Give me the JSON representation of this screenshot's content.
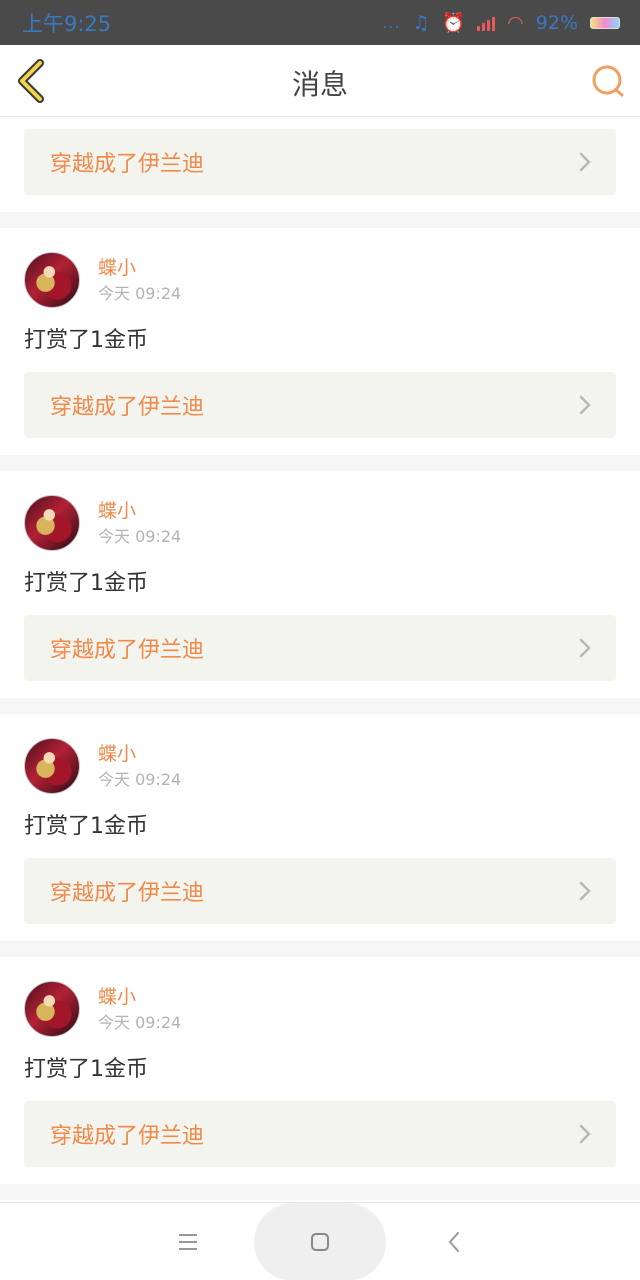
{
  "status_bar": {
    "time": "上午9:25",
    "dots": "...",
    "battery_percent": "92%"
  },
  "header": {
    "title": "消息",
    "back_icon": "chevron-left-icon",
    "search_icon": "search-icon"
  },
  "first_item": {
    "link_text": "穿越成了伊兰迪"
  },
  "messages": [
    {
      "username": "蝶小",
      "time": "今天 09:24",
      "text": "打赏了1金币",
      "link_text": "穿越成了伊兰迪"
    },
    {
      "username": "蝶小",
      "time": "今天 09:24",
      "text": "打赏了1金币",
      "link_text": "穿越成了伊兰迪"
    },
    {
      "username": "蝶小",
      "time": "今天 09:24",
      "text": "打赏了1金币",
      "link_text": "穿越成了伊兰迪"
    },
    {
      "username": "蝶小",
      "time": "今天 09:24",
      "text": "打赏了1金币",
      "link_text": "穿越成了伊兰迪"
    }
  ],
  "navbar": {
    "menu_icon": "menu-icon",
    "home_icon": "home-square-icon",
    "back_icon": "back-arrow-icon"
  },
  "colors": {
    "accent": "#f0894a",
    "link_bg": "#f4f4ee",
    "status_bar_bg": "#4a4a4a"
  }
}
